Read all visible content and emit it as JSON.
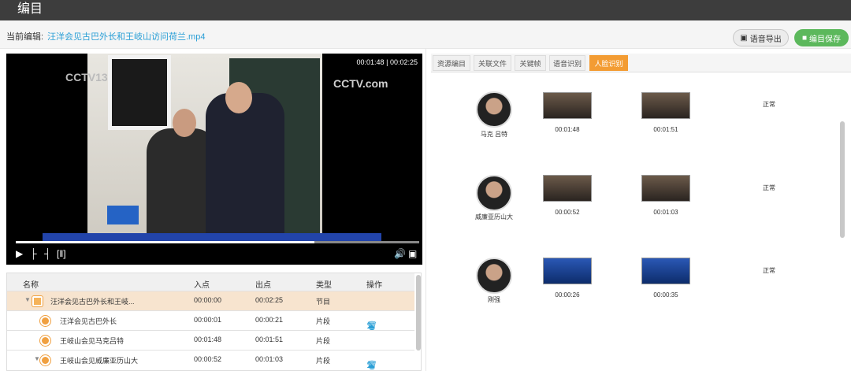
{
  "app": {
    "title": "编目"
  },
  "header": {
    "current_label": "当前编辑:",
    "file_name": "汪洋会见古巴外长和王岐山访问荷兰.mp4",
    "audio_export_label": "语音导出",
    "save_label": "编目保存"
  },
  "player": {
    "current_time": "00:01:48",
    "separator": "|",
    "duration": "00:02:25",
    "progress": 0.74,
    "watermark_tl": "CCTV13",
    "watermark_tr": "CCTV.com"
  },
  "table": {
    "headers": [
      "名称",
      "入点",
      "出点",
      "类型",
      "操作"
    ],
    "rows": [
      {
        "name": "汪洋会见古巴外长和王岐...",
        "in": "00:00:00",
        "out": "00:02:25",
        "type": "节目",
        "level": "program"
      },
      {
        "name": "汪洋会见古巴外长",
        "in": "00:00:01",
        "out": "00:00:21",
        "type": "片段",
        "level": "clip"
      },
      {
        "name": "王岐山会见马克吕特",
        "in": "00:01:48",
        "out": "00:01:51",
        "type": "片段",
        "level": "clip"
      },
      {
        "name": "王岐山会见威廉亚历山大",
        "in": "00:00:52",
        "out": "00:01:03",
        "type": "片段",
        "level": "clip"
      }
    ]
  },
  "tabs": [
    {
      "label": "资源编目",
      "active": false
    },
    {
      "label": "关联文件",
      "active": false
    },
    {
      "label": "关键帧",
      "active": false
    },
    {
      "label": "语音识别",
      "active": false
    },
    {
      "label": "人脸识别",
      "active": true
    }
  ],
  "faces": [
    {
      "name": "马克 吕特",
      "t1": "00:01:48",
      "t2": "00:01:51",
      "status": "正常",
      "thumb": "brown"
    },
    {
      "name": "威廉亚历山大",
      "t1": "00:00:52",
      "t2": "00:01:03",
      "status": "正常",
      "thumb": "brown"
    },
    {
      "name": "刚强",
      "t1": "00:00:26",
      "t2": "00:00:35",
      "status": "正常",
      "thumb": "blue"
    }
  ],
  "colors": {
    "accent_orange": "#f39c33",
    "save_green": "#5cb85c",
    "link_blue": "#2a9fd6",
    "topbar": "#3d3d3d"
  }
}
